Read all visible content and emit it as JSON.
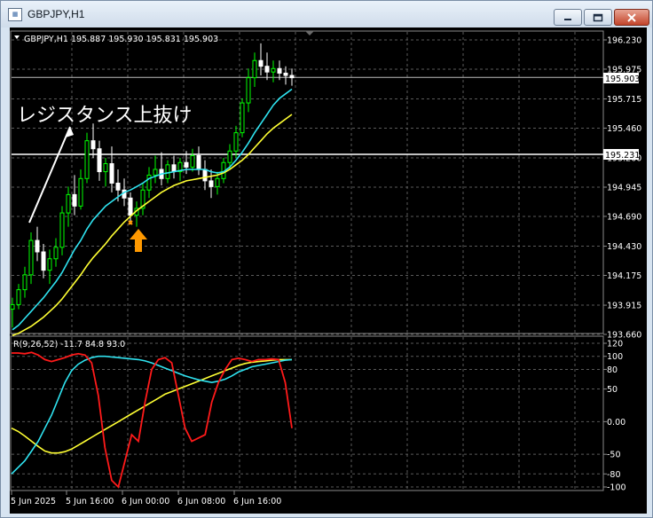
{
  "window": {
    "title": "GBPJPY,H1"
  },
  "chart_header": "GBPJPY,H1  195.887 195.930 195.831 195.903",
  "annotation": "レジスタンス上抜け",
  "price_axis": [
    "196.230",
    "195.975",
    "195.715",
    "195.460",
    "195.200",
    "194.945",
    "194.690",
    "194.430",
    "194.175",
    "193.915",
    "193.660"
  ],
  "current_price_label": "195.903",
  "resistance_label": "195.231",
  "indicator_header": "R(9,26,52) -11.7 84.8 93.0",
  "indicator_axis": [
    "120",
    "100",
    "80",
    "50",
    "0.00",
    "-50",
    "-80",
    "-100"
  ],
  "time_axis": [
    "5 Jun 2025",
    "5 Jun 16:00",
    "6 Jun 00:00",
    "6 Jun 08:00",
    "6 Jun 16:00"
  ],
  "colors": {
    "bull": "#00ff00",
    "bear": "#ffffff",
    "ma_fast": "#2fe3f0",
    "ma_slow": "#ffff33",
    "osc_red": "#ff1a1a",
    "arrow": "#ff9900"
  },
  "chart_data": {
    "type": "line",
    "x_unit": "hour",
    "candles": [
      [
        193.88,
        193.98,
        193.72,
        193.92
      ],
      [
        193.92,
        194.1,
        193.88,
        194.05
      ],
      [
        194.05,
        194.25,
        193.98,
        194.18
      ],
      [
        194.18,
        194.55,
        194.1,
        194.48
      ],
      [
        194.48,
        194.6,
        194.3,
        194.38
      ],
      [
        194.38,
        194.45,
        194.15,
        194.22
      ],
      [
        194.22,
        194.4,
        194.1,
        194.32
      ],
      [
        194.32,
        194.5,
        194.25,
        194.42
      ],
      [
        194.42,
        194.78,
        194.35,
        194.72
      ],
      [
        194.72,
        194.95,
        194.6,
        194.88
      ],
      [
        194.88,
        195.05,
        194.7,
        194.78
      ],
      [
        194.78,
        195.1,
        194.75,
        195.02
      ],
      [
        195.02,
        195.42,
        194.98,
        195.35
      ],
      [
        195.35,
        195.5,
        195.2,
        195.28
      ],
      [
        195.28,
        195.35,
        195.0,
        195.08
      ],
      [
        195.08,
        195.2,
        194.95,
        195.15
      ],
      [
        195.15,
        195.3,
        194.9,
        194.98
      ],
      [
        194.98,
        195.1,
        194.82,
        194.92
      ],
      [
        194.92,
        195.02,
        194.78,
        194.85
      ],
      [
        194.85,
        194.9,
        194.62,
        194.7
      ],
      [
        194.7,
        194.82,
        194.6,
        194.76
      ],
      [
        194.76,
        194.98,
        194.7,
        194.92
      ],
      [
        194.92,
        195.12,
        194.85,
        195.05
      ],
      [
        195.05,
        195.22,
        194.98,
        195.1
      ],
      [
        195.1,
        195.25,
        194.96,
        195.02
      ],
      [
        195.02,
        195.18,
        194.98,
        195.14
      ],
      [
        195.14,
        195.22,
        195.02,
        195.08
      ],
      [
        195.08,
        195.2,
        195.0,
        195.16
      ],
      [
        195.16,
        195.26,
        195.06,
        195.12
      ],
      [
        195.12,
        195.28,
        195.08,
        195.22
      ],
      [
        195.22,
        195.3,
        195.05,
        195.1
      ],
      [
        195.1,
        195.18,
        194.92,
        195.0
      ],
      [
        195.0,
        195.1,
        194.85,
        194.95
      ],
      [
        194.95,
        195.08,
        194.88,
        195.02
      ],
      [
        195.02,
        195.2,
        194.98,
        195.16
      ],
      [
        195.16,
        195.32,
        195.1,
        195.26
      ],
      [
        195.26,
        195.48,
        195.2,
        195.42
      ],
      [
        195.42,
        195.72,
        195.38,
        195.68
      ],
      [
        195.68,
        195.98,
        195.6,
        195.9
      ],
      [
        195.9,
        196.12,
        195.82,
        196.05
      ],
      [
        196.05,
        196.2,
        195.92,
        196.0
      ],
      [
        196.0,
        196.12,
        195.88,
        195.95
      ],
      [
        195.95,
        196.05,
        195.86,
        195.98
      ],
      [
        195.98,
        196.05,
        195.88,
        195.94
      ],
      [
        195.94,
        196.0,
        195.84,
        195.92
      ],
      [
        195.92,
        195.98,
        195.83,
        195.9
      ]
    ],
    "ma_fast": [
      193.7,
      193.74,
      193.8,
      193.86,
      193.92,
      193.98,
      194.05,
      194.12,
      194.2,
      194.3,
      194.4,
      194.48,
      194.58,
      194.66,
      194.72,
      194.78,
      194.82,
      194.86,
      194.9,
      194.92,
      194.95,
      194.98,
      195.02,
      195.04,
      195.06,
      195.07,
      195.08,
      195.09,
      195.1,
      195.1,
      195.1,
      195.1,
      195.08,
      195.07,
      195.08,
      195.12,
      195.18,
      195.25,
      195.33,
      195.42,
      195.5,
      195.58,
      195.66,
      195.72,
      195.76,
      195.8
    ],
    "ma_slow": [
      193.65,
      193.67,
      193.7,
      193.73,
      193.77,
      193.81,
      193.86,
      193.91,
      193.97,
      194.04,
      194.11,
      194.18,
      194.26,
      194.33,
      194.39,
      194.45,
      194.52,
      194.58,
      194.64,
      194.69,
      194.74,
      194.78,
      194.82,
      194.86,
      194.9,
      194.93,
      194.96,
      194.98,
      195.0,
      195.01,
      195.02,
      195.03,
      195.04,
      195.05,
      195.07,
      195.1,
      195.14,
      195.18,
      195.23,
      195.29,
      195.35,
      195.41,
      195.46,
      195.5,
      195.54,
      195.58
    ],
    "osc_red": [
      105,
      105,
      104,
      106,
      102,
      95,
      92,
      95,
      98,
      102,
      104,
      102,
      90,
      40,
      -40,
      -90,
      -100,
      -60,
      -20,
      -30,
      30,
      80,
      95,
      98,
      90,
      40,
      -10,
      -30,
      -25,
      -20,
      30,
      60,
      80,
      95,
      97,
      95,
      92,
      95,
      95,
      96,
      95,
      60,
      -10
    ],
    "osc_cyan": [
      -80,
      -70,
      -60,
      -45,
      -30,
      -10,
      10,
      35,
      60,
      78,
      88,
      94,
      98,
      100,
      100,
      99,
      98,
      97,
      96,
      95,
      93,
      90,
      86,
      82,
      78,
      74,
      70,
      67,
      64,
      62,
      60,
      62,
      65,
      70,
      76,
      80,
      84,
      86,
      88,
      90,
      92,
      94,
      95
    ],
    "osc_yellow": [
      -10,
      -15,
      -22,
      -30,
      -38,
      -45,
      -48,
      -48,
      -46,
      -42,
      -36,
      -30,
      -24,
      -18,
      -12,
      -6,
      0,
      6,
      12,
      18,
      24,
      30,
      36,
      42,
      46,
      50,
      54,
      58,
      62,
      66,
      70,
      74,
      78,
      82,
      86,
      89,
      91,
      92,
      93,
      94,
      95,
      95,
      95
    ],
    "resistance_level": 195.231,
    "current_price": 195.903,
    "price_ylim": [
      193.66,
      196.23
    ],
    "indicator_ylim": [
      -100,
      120
    ],
    "signal_candle_index": 19
  }
}
